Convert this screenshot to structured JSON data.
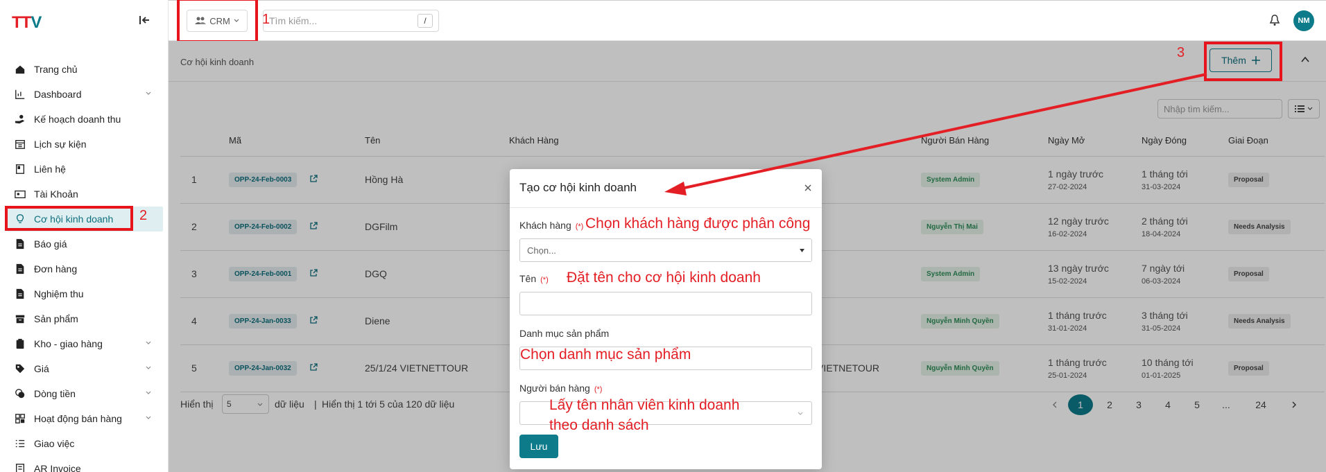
{
  "app": {
    "logo_left": "TT",
    "logo_right": "V"
  },
  "topbar": {
    "module": "CRM",
    "search_placeholder": "Tìm kiếm...",
    "search_shortcut": "/",
    "avatar": "NM"
  },
  "sidebar": {
    "items": [
      {
        "label": "Trang chủ",
        "icon": "home-icon"
      },
      {
        "label": "Dashboard",
        "icon": "chart-icon",
        "expandable": true
      },
      {
        "label": "Kế hoạch doanh thu",
        "icon": "hand-coin-icon"
      },
      {
        "label": "Lịch sự kiện",
        "icon": "calendar-icon"
      },
      {
        "label": "Liên hệ",
        "icon": "contact-book-icon"
      },
      {
        "label": "Tài Khoản",
        "icon": "id-card-icon"
      },
      {
        "label": "Cơ hội kinh doanh",
        "icon": "lightbulb-icon",
        "active": true
      },
      {
        "label": "Báo giá",
        "icon": "document-icon"
      },
      {
        "label": "Đơn hàng",
        "icon": "document-icon"
      },
      {
        "label": "Nghiệm thu",
        "icon": "document-icon"
      },
      {
        "label": "Sản phẩm",
        "icon": "box-icon"
      },
      {
        "label": "Kho - giao hàng",
        "icon": "clipboard-icon",
        "expandable": true
      },
      {
        "label": "Giá",
        "icon": "tag-icon",
        "expandable": true
      },
      {
        "label": "Dòng tiền",
        "icon": "coins-icon",
        "expandable": true
      },
      {
        "label": "Hoạt động bán hàng",
        "icon": "grid-icon",
        "expandable": true
      },
      {
        "label": "Giao việc",
        "icon": "task-list-icon"
      },
      {
        "label": "AR Invoice",
        "icon": "invoice-icon"
      }
    ]
  },
  "page": {
    "breadcrumb": "Cơ hội kinh doanh",
    "add_label": "Thêm",
    "table_search_placeholder": "Nhập tìm kiếm...",
    "columns": [
      "Mã",
      "Tên",
      "Khách Hàng",
      "Người Bán Hàng",
      "Ngày Mở",
      "Ngày Đóng",
      "Giai Đoạn"
    ],
    "rows": [
      {
        "idx": "1",
        "code": "OPP-24-Feb-0003",
        "name": "Hồng Hà",
        "customer": "",
        "seller": "System Admin",
        "open_rel": "1 ngày trước",
        "open_date": "27-02-2024",
        "close_rel": "1 tháng tới",
        "close_date": "31-03-2024",
        "stage": "Proposal"
      },
      {
        "idx": "2",
        "code": "OPP-24-Feb-0002",
        "name": "DGFilm",
        "customer": "",
        "seller": "Nguyễn Thị Mai",
        "open_rel": "12 ngày trước",
        "open_date": "16-02-2024",
        "close_rel": "2 tháng tới",
        "close_date": "18-04-2024",
        "stage": "Needs Analysis"
      },
      {
        "idx": "3",
        "code": "OPP-24-Feb-0001",
        "name": "DGQ",
        "customer": "",
        "seller": "System Admin",
        "open_rel": "13 ngày trước",
        "open_date": "15-02-2024",
        "close_rel": "7 ngày tới",
        "close_date": "06-03-2024",
        "stage": "Proposal"
      },
      {
        "idx": "4",
        "code": "OPP-24-Jan-0033",
        "name": "Diene",
        "customer": "",
        "seller": "Nguyễn Minh Quyền",
        "open_rel": "1 tháng trước",
        "open_date": "31-01-2024",
        "close_rel": "3 tháng tới",
        "close_date": "31-05-2024",
        "stage": "Needs Analysis"
      },
      {
        "idx": "5",
        "code": "OPP-24-Jan-0032",
        "name": "25/1/24 VIETNETTOUR",
        "customer": "U VIETNETOUR",
        "seller": "Nguyễn Minh Quyền",
        "open_rel": "1 tháng trước",
        "open_date": "25-01-2024",
        "close_rel": "10 tháng tới",
        "close_date": "01-01-2025",
        "stage": "Proposal"
      }
    ],
    "footer": {
      "show_label": "Hiển thị",
      "page_size": "5",
      "records_label": "dữ liệu",
      "summary": "Hiển thị 1 tới 5 của 120 dữ liệu"
    },
    "pagination": [
      "1",
      "2",
      "3",
      "4",
      "5",
      "...",
      "24"
    ]
  },
  "modal": {
    "title": "Tạo cơ hội kinh doanh",
    "customer_label": "Khách hàng",
    "required_mark": "(*)",
    "customer_placeholder": "Chọn...",
    "name_label": "Tên",
    "category_label": "Danh mục sản phẩm",
    "seller_label": "Người bán hàng",
    "save_label": "Lưu"
  },
  "annotations": {
    "n1": "1",
    "n2": "2",
    "n3": "3",
    "customer_note": "Chọn khách hàng được phân công",
    "name_note": "Đặt tên cho cơ hội kinh doanh",
    "category_note": "Chọn danh mục sản phẩm",
    "seller_note_line1": "Lấy tên nhân viên kinh doanh",
    "seller_note_line2": "theo danh sách"
  },
  "colors": {
    "primary": "#0d7b8a",
    "annotation": "#e31e24"
  }
}
